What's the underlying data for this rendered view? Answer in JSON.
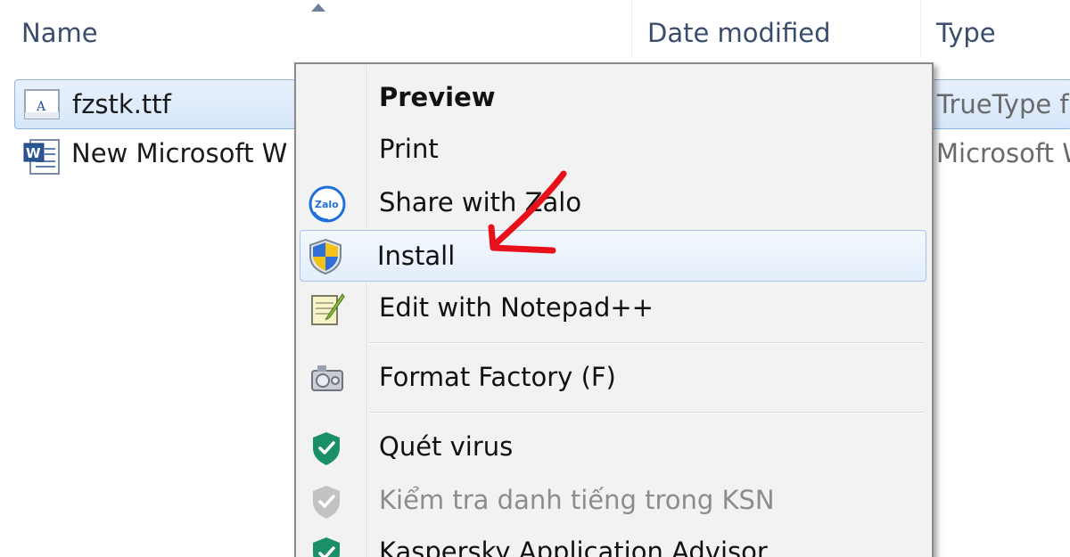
{
  "columns": {
    "name": "Name",
    "date_modified": "Date modified",
    "type": "Type"
  },
  "files": [
    {
      "name": "fzstk.ttf",
      "type": "TrueType f",
      "icon": "font-file-icon",
      "selected": true
    },
    {
      "name": "New Microsoft W",
      "type": "Microsoft W",
      "icon": "word-document-icon",
      "selected": false
    }
  ],
  "context_menu": {
    "items": {
      "preview": {
        "label": "Preview",
        "default": true
      },
      "print": {
        "label": "Print"
      },
      "share_zalo": {
        "label": "Share with Zalo",
        "icon": "zalo-icon",
        "icon_text": "Zalo"
      },
      "install": {
        "label": "Install",
        "icon": "uac-shield-icon",
        "highlighted": true
      },
      "edit_notepad": {
        "label": "Edit with Notepad++",
        "icon": "notepad-plus-plus-icon"
      },
      "format_factory": {
        "label": "Format Factory (F)",
        "icon": "format-factory-icon"
      },
      "quet_virus": {
        "label": "Quét virus",
        "icon": "kaspersky-shield-icon"
      },
      "ksn": {
        "label": "Kiểm tra danh tiếng trong KSN",
        "icon": "kaspersky-shield-gray-icon",
        "disabled": true
      },
      "kaspersky_advisor": {
        "label": "Kaspersky Application Advisor",
        "icon": "kaspersky-shield-icon"
      }
    }
  },
  "colors": {
    "selection_border": "#8cb3e6",
    "menu_background": "#f2f2f2",
    "annotation_arrow": "#e8101a",
    "kaspersky_green": "#1a8f6a"
  }
}
